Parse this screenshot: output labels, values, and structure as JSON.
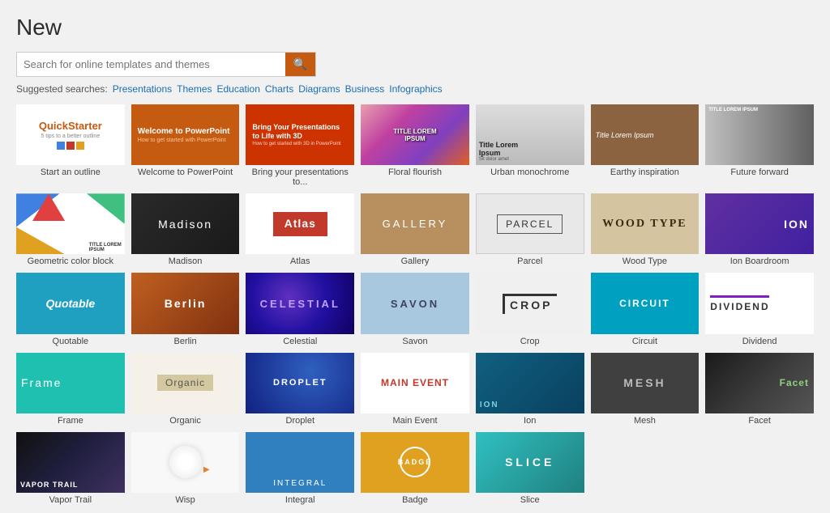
{
  "page": {
    "title": "New"
  },
  "search": {
    "placeholder": "Search for online templates and themes"
  },
  "suggested": {
    "label": "Suggested searches:",
    "links": [
      "Presentations",
      "Themes",
      "Education",
      "Charts",
      "Diagrams",
      "Business",
      "Infographics"
    ]
  },
  "templates": [
    {
      "id": "quickstarter",
      "label": "Start an outline",
      "style": "quickstarter"
    },
    {
      "id": "welcome",
      "label": "Welcome to PowerPoint",
      "style": "welcome"
    },
    {
      "id": "bring",
      "label": "Bring your presentations to...",
      "style": "bring"
    },
    {
      "id": "floral",
      "label": "Floral flourish",
      "style": "floral"
    },
    {
      "id": "urban",
      "label": "Urban monochrome",
      "style": "urban"
    },
    {
      "id": "earthy",
      "label": "Earthy inspiration",
      "style": "earthy"
    },
    {
      "id": "future",
      "label": "Future forward",
      "style": "future"
    },
    {
      "id": "geo",
      "label": "Geometric color block",
      "style": "geo"
    },
    {
      "id": "madison",
      "label": "Madison",
      "style": "madison"
    },
    {
      "id": "atlas",
      "label": "Atlas",
      "style": "atlas"
    },
    {
      "id": "gallery",
      "label": "Gallery",
      "style": "gallery"
    },
    {
      "id": "parcel",
      "label": "Parcel",
      "style": "parcel"
    },
    {
      "id": "woodtype",
      "label": "Wood Type",
      "style": "woodtype"
    },
    {
      "id": "ion",
      "label": "Ion Boardroom",
      "style": "ion"
    },
    {
      "id": "quotable",
      "label": "Quotable",
      "style": "quotable"
    },
    {
      "id": "berlin",
      "label": "Berlin",
      "style": "berlin"
    },
    {
      "id": "celestial",
      "label": "Celestial",
      "style": "celestial"
    },
    {
      "id": "savon",
      "label": "Savon",
      "style": "savon"
    },
    {
      "id": "crop",
      "label": "Crop",
      "style": "crop"
    },
    {
      "id": "circuit",
      "label": "Circuit",
      "style": "circuit"
    },
    {
      "id": "dividend",
      "label": "Dividend",
      "style": "dividend"
    },
    {
      "id": "frame",
      "label": "Frame",
      "style": "frame"
    },
    {
      "id": "organic",
      "label": "Organic",
      "style": "organic"
    },
    {
      "id": "droplet",
      "label": "Droplet",
      "style": "droplet"
    },
    {
      "id": "mainevent",
      "label": "Main Event",
      "style": "mainevent"
    },
    {
      "id": "ion2",
      "label": "Ion",
      "style": "ion2"
    },
    {
      "id": "mesh",
      "label": "Mesh",
      "style": "mesh"
    },
    {
      "id": "facet",
      "label": "Facet",
      "style": "facet"
    },
    {
      "id": "vaportrail",
      "label": "Vapor Trail",
      "style": "vaportrail"
    },
    {
      "id": "wisp",
      "label": "Wisp",
      "style": "wisp"
    },
    {
      "id": "integral",
      "label": "Integral",
      "style": "integral"
    },
    {
      "id": "badge",
      "label": "Badge",
      "style": "badge"
    },
    {
      "id": "slice",
      "label": "Slice",
      "style": "slice"
    }
  ]
}
